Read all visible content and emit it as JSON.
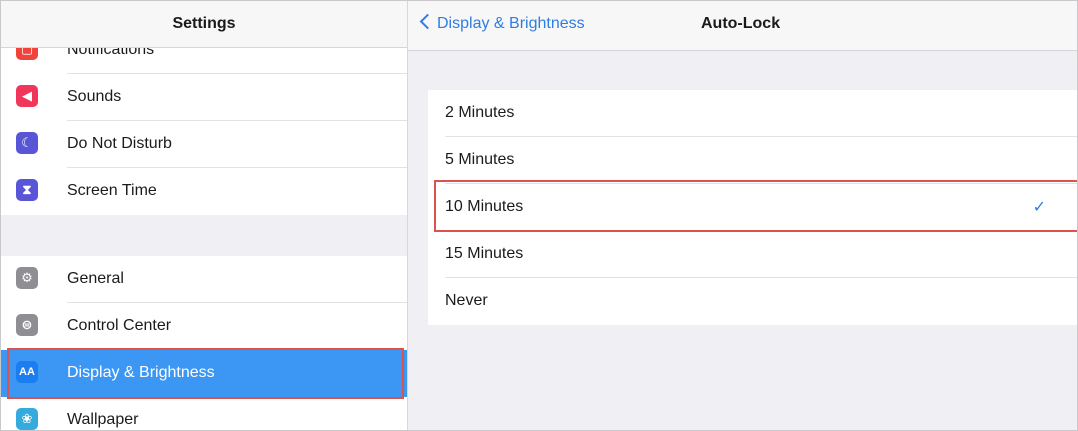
{
  "left_header": {
    "title": "Settings"
  },
  "sidebar": {
    "group1": [
      {
        "label": "Notifications",
        "icon": "notifications-icon",
        "color": "#f0433a"
      },
      {
        "label": "Sounds",
        "icon": "speaker-icon",
        "color": "#f0365a"
      },
      {
        "label": "Do Not Disturb",
        "icon": "moon-icon",
        "color": "#5856d6"
      },
      {
        "label": "Screen Time",
        "icon": "hourglass-icon",
        "color": "#5856d6"
      }
    ],
    "group2": [
      {
        "label": "General",
        "icon": "gear-icon",
        "color": "#8e8e93"
      },
      {
        "label": "Control Center",
        "icon": "toggles-icon",
        "color": "#8e8e93"
      },
      {
        "label": "Display & Brightness",
        "icon": "text-size-icon",
        "color": "#1a7ef1",
        "selected": true
      },
      {
        "label": "Wallpaper",
        "icon": "flower-icon",
        "color": "#35aadc"
      }
    ]
  },
  "right_header": {
    "back_label": "Display & Brightness",
    "title": "Auto-Lock"
  },
  "options": [
    {
      "label": "2 Minutes"
    },
    {
      "label": "5 Minutes"
    },
    {
      "label": "10 Minutes",
      "checked": true
    },
    {
      "label": "15 Minutes"
    },
    {
      "label": "Never"
    }
  ],
  "check_glyph": "✓"
}
